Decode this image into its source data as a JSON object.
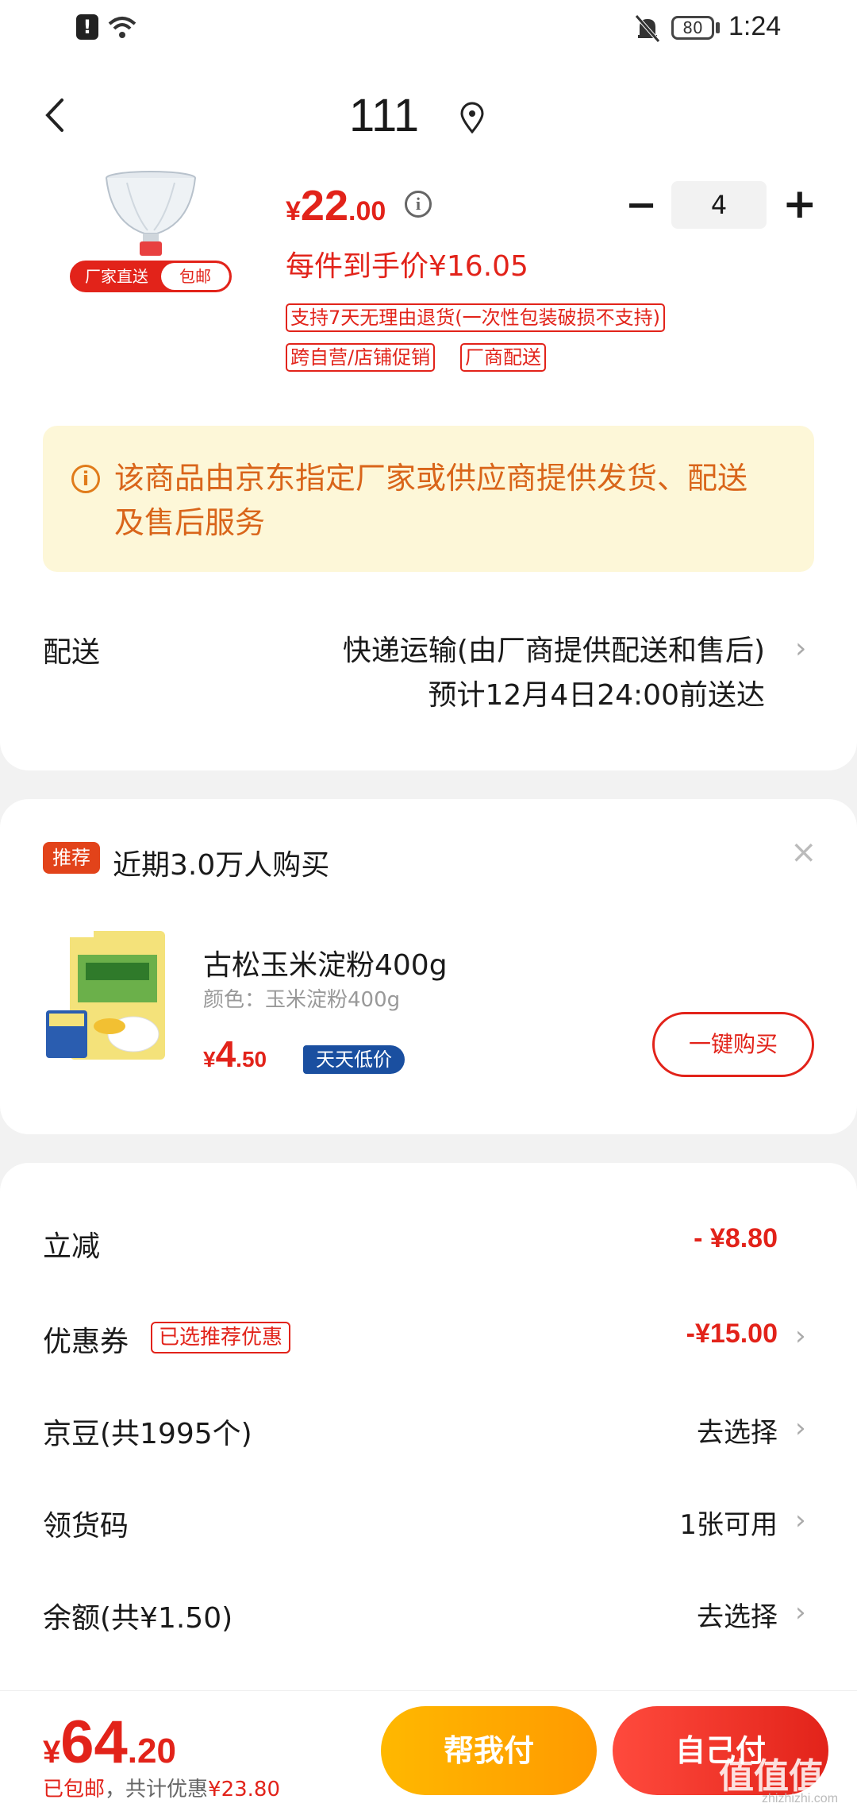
{
  "status_bar": {
    "time": "1:24",
    "battery": "80"
  },
  "header": {
    "title": "111"
  },
  "product": {
    "tag_left": "厂家直送",
    "tag_right": "包邮",
    "price_currency": "¥",
    "price_int": "22",
    "price_dec": ".00",
    "quantity": "4",
    "per_item_price": "每件到手价¥16.05",
    "chips": [
      "支持7天无理由退货(一次性包装破损不支持)",
      "跨自营/店铺促销",
      "厂商配送"
    ]
  },
  "notice": {
    "text": "该商品由京东指定厂家或供应商提供发货、配送及售后服务"
  },
  "shipping": {
    "label": "配送",
    "method": "快递运输(由厂商提供配送和售后)",
    "eta": "预计12月4日24:00前送达"
  },
  "recommend": {
    "badge": "推荐",
    "title": "近期3.0万人购买",
    "item_name": "古松玉米淀粉400g",
    "item_color": "颜色：玉米淀粉400g",
    "price_currency": "¥",
    "price_int": "4",
    "price_dec": ".50",
    "low_badge": "天天低价",
    "buy_label": "一键购买"
  },
  "discounts": {
    "rows": [
      {
        "label": "立减",
        "value": "- ¥8.80"
      },
      {
        "label": "优惠券",
        "tag": "已选推荐优惠",
        "value": "-¥15.00"
      },
      {
        "label": "京豆(共1995个)",
        "value": "去选择"
      },
      {
        "label": "领货码",
        "value": "1张可用"
      },
      {
        "label": "余额(共¥1.50)",
        "value": "去选择"
      }
    ]
  },
  "footer": {
    "total_currency": "¥",
    "total_int": "64",
    "total_dec": ".20",
    "sub_prefix": "已包邮",
    "sub_middle": "，共计优惠",
    "sub_amount": "¥23.80",
    "help_pay": "帮我付",
    "self_pay": "自己付",
    "watermark": "值值值",
    "watermark_sub": "zhizhizhi.com"
  },
  "colors": {
    "accent": "#e2231a",
    "notice_bg": "#fdf7d8",
    "notice_text": "#d9651a",
    "low_badge": "#1a4fa0"
  }
}
